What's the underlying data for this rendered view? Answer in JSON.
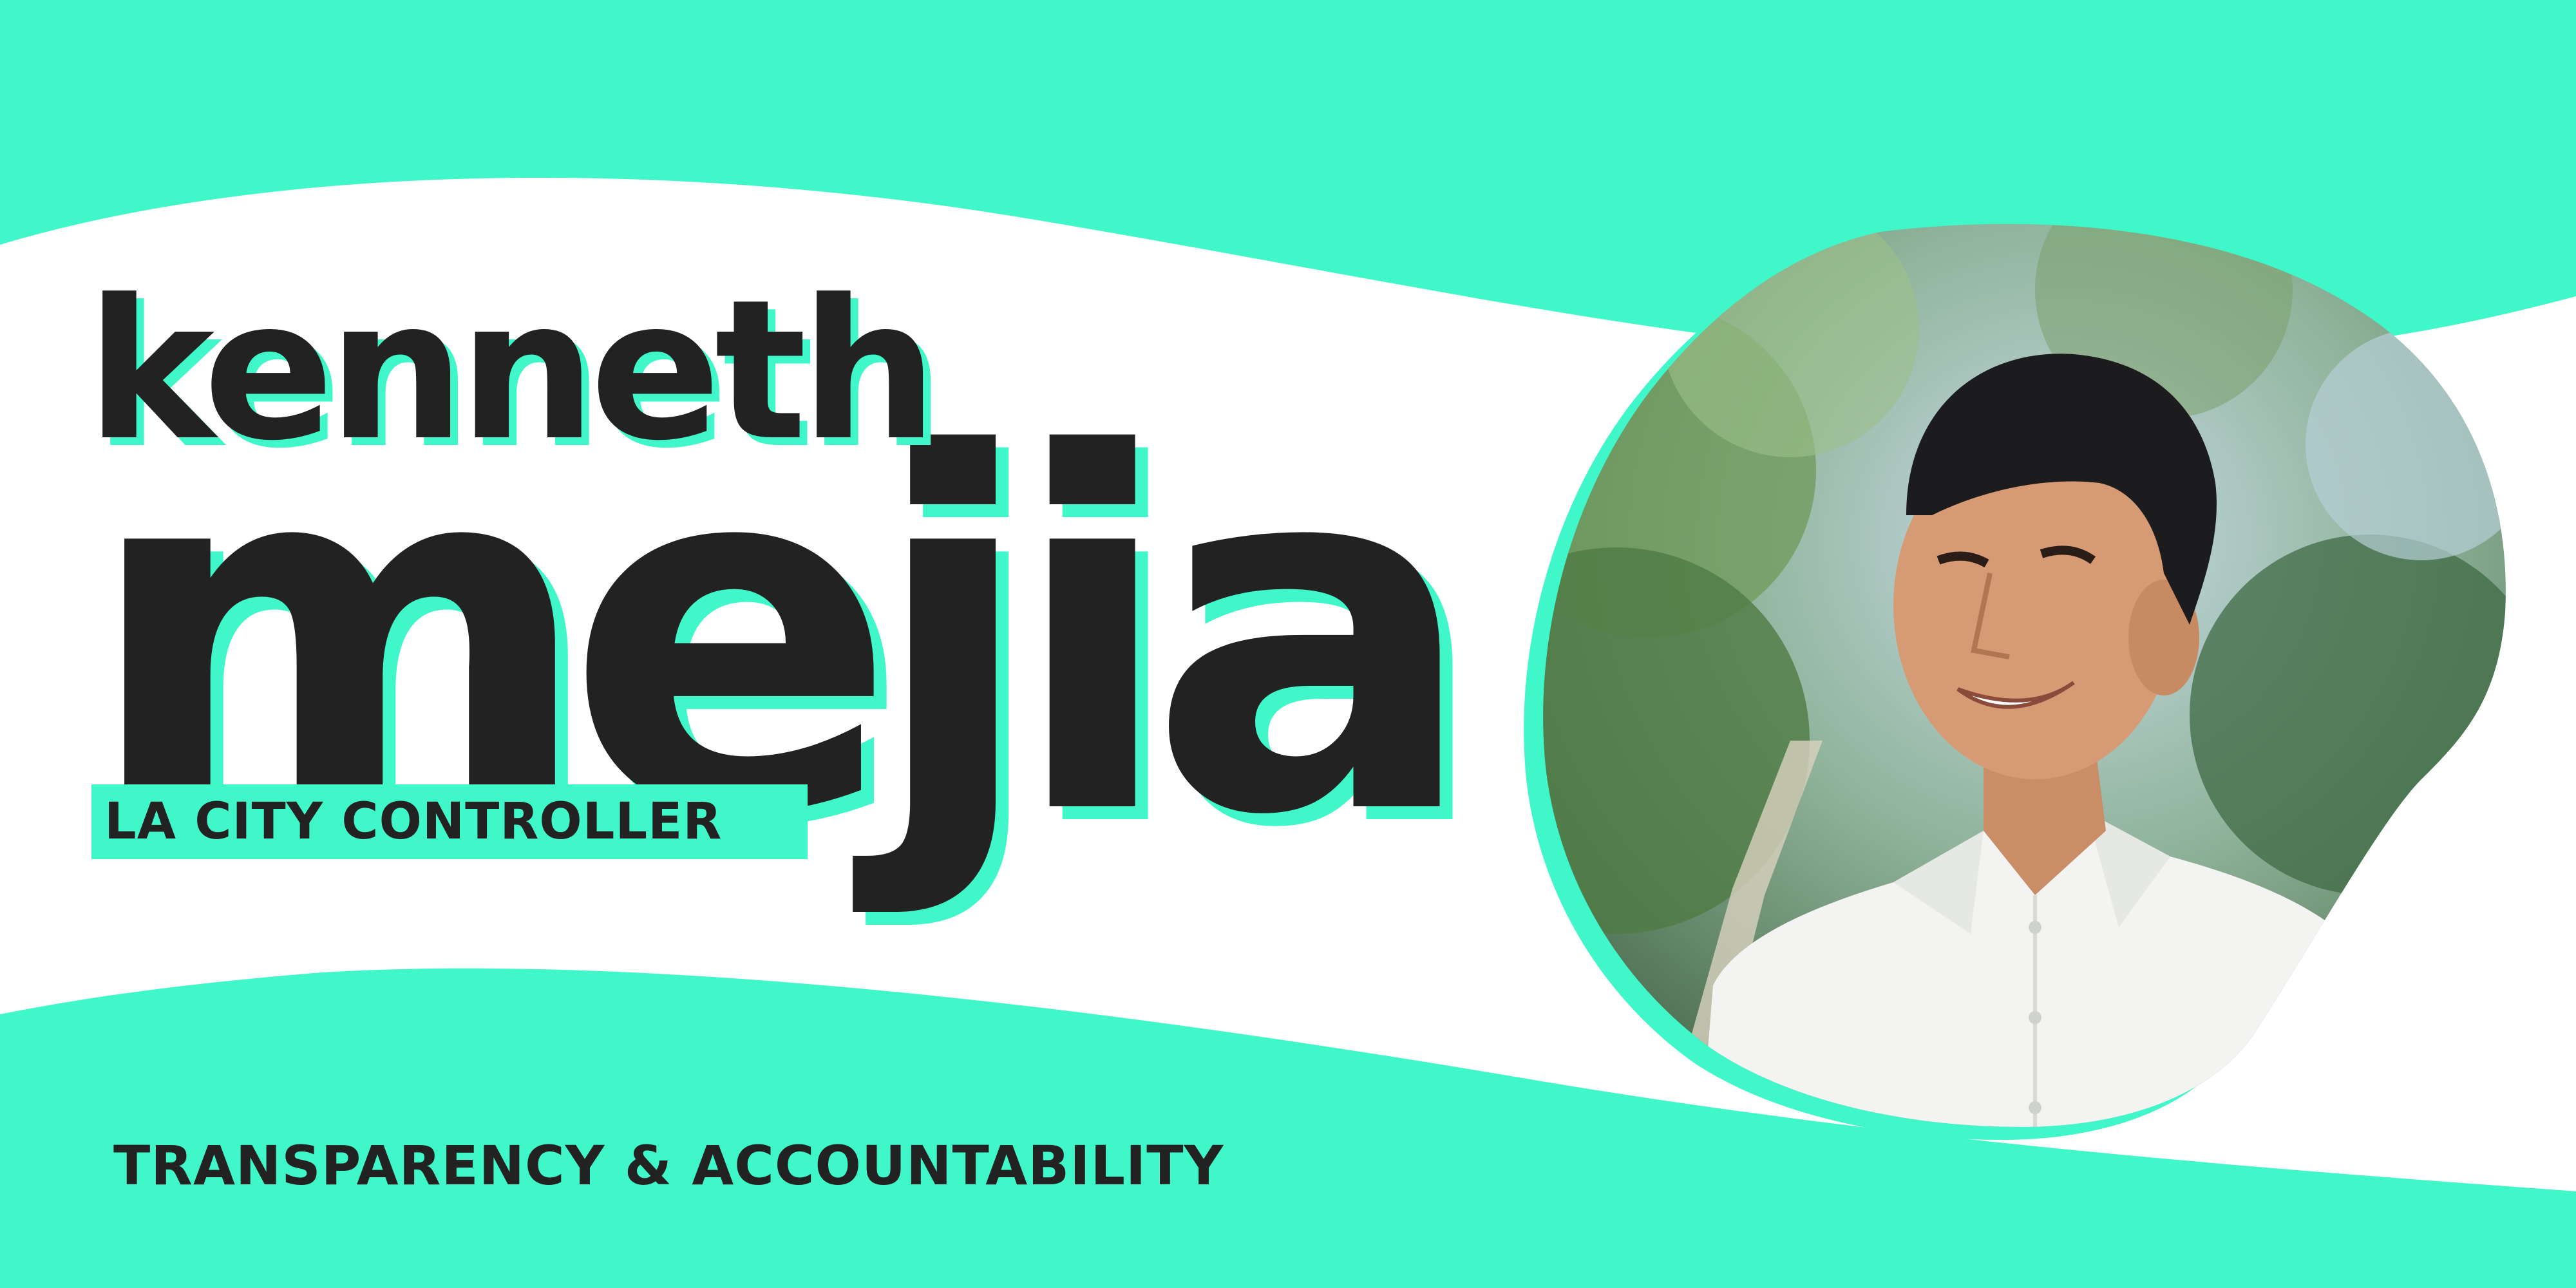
{
  "candidate": {
    "first_name": "kenneth",
    "last_name": "mejia"
  },
  "role": "LA CITY CONTROLLER",
  "slogan": "TRANSPARENCY & ACCOUNTABILITY",
  "colors": {
    "accent": "#3ff7c8",
    "text": "#222222",
    "background": "#ffffff"
  },
  "photo": {
    "subject": "smiling man in white shirt in front of green trees"
  }
}
